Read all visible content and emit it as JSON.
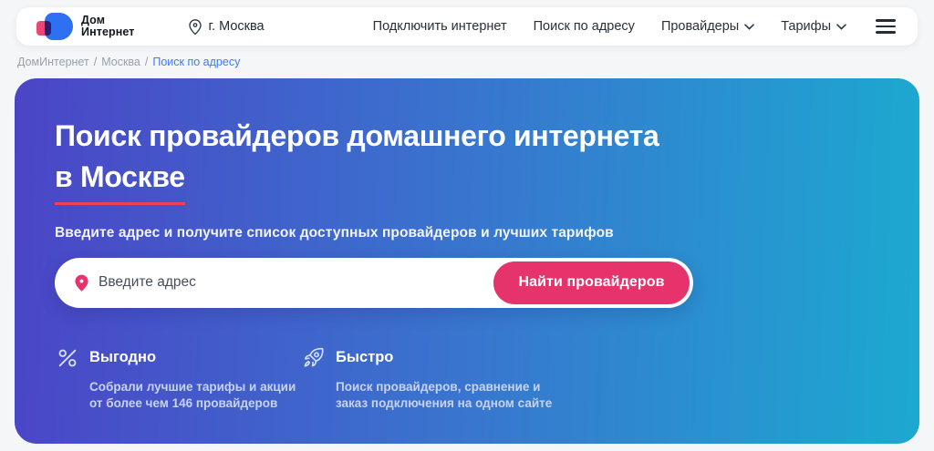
{
  "navbar": {
    "logo": {
      "line1": "Дом",
      "line2": "Интернет"
    },
    "location": {
      "label": "г. Москва",
      "icon": "location-pin-outline-icon"
    },
    "links": [
      {
        "label": "Подключить интернет",
        "has_dropdown": false
      },
      {
        "label": "Поиск по адресу",
        "has_dropdown": false
      },
      {
        "label": "Провайдеры",
        "has_dropdown": true
      },
      {
        "label": "Тарифы",
        "has_dropdown": true
      }
    ],
    "menu_icon": "hamburger-menu-icon"
  },
  "breadcrumb": {
    "separator": "/",
    "items": [
      {
        "label": "ДомИнтернет",
        "active": false
      },
      {
        "label": "Москва",
        "active": false
      },
      {
        "label": "Поиск по адресу",
        "active": true
      }
    ]
  },
  "hero": {
    "title_line1": "Поиск провайдеров домашнего интернета",
    "title_line2": "в Москве",
    "subtitle": "Введите адрес и получите список доступных провайдеров и лучших тарифов",
    "search": {
      "placeholder": "Введите адрес",
      "pin_icon": "location-pin-filled-icon",
      "button_label": "Найти провайдеров"
    },
    "features": [
      {
        "icon": "percent-icon",
        "title": "Выгодно",
        "desc_line1": "Собрали лучшие тарифы и акции",
        "desc_line2": "от более чем 146 провайдеров"
      },
      {
        "icon": "rocket-icon",
        "title": "Быстро",
        "desc_line1": "Поиск провайдеров, сравнение и",
        "desc_line2": "заказ подключения на одном сайте"
      }
    ],
    "colors": {
      "gradient_start": "#4b45c6",
      "gradient_mid": "#3877cf",
      "gradient_end": "#1ca9d0",
      "accent_pink": "#e6336b",
      "underline_red": "#ec4256",
      "breadcrumb_link_blue": "#3c7bf6"
    }
  }
}
